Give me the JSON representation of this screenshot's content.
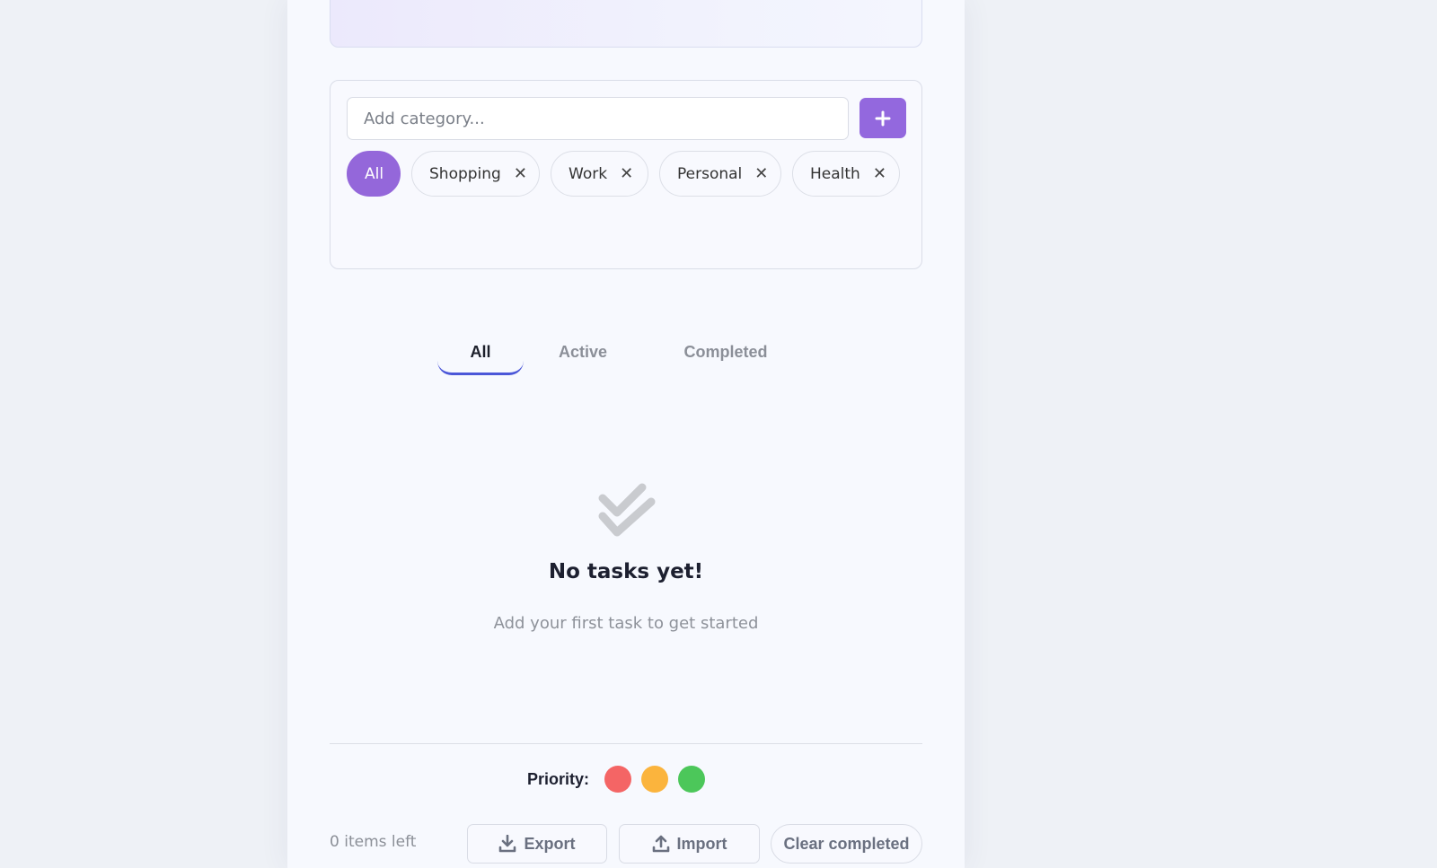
{
  "category": {
    "input_placeholder": "Add category...",
    "add_icon": "plus-icon",
    "chips": [
      {
        "label": "All",
        "active": true,
        "removable": false
      },
      {
        "label": "Shopping",
        "active": false,
        "removable": true
      },
      {
        "label": "Work",
        "active": false,
        "removable": true
      },
      {
        "label": "Personal",
        "active": false,
        "removable": true
      },
      {
        "label": "Health",
        "active": false,
        "removable": true
      }
    ],
    "remove_glyph": "✕"
  },
  "filters": {
    "tabs": [
      {
        "label": "All",
        "active": true
      },
      {
        "label": "Active",
        "active": false
      },
      {
        "label": "Completed",
        "active": false
      }
    ]
  },
  "empty_state": {
    "icon": "double-check-icon",
    "title": "No tasks yet!",
    "subtitle": "Add your first task to get started"
  },
  "priority": {
    "label": "Priority:",
    "levels": [
      {
        "name": "high",
        "color": "#f46565"
      },
      {
        "name": "medium",
        "color": "#fbb43d"
      },
      {
        "name": "low",
        "color": "#4cc75a"
      }
    ]
  },
  "footer": {
    "items_left": "0 items left",
    "export_label": "Export",
    "import_label": "Import",
    "clear_label": "Clear completed"
  },
  "colors": {
    "accent": "#9467da",
    "tab_underline": "#4b57d8"
  }
}
